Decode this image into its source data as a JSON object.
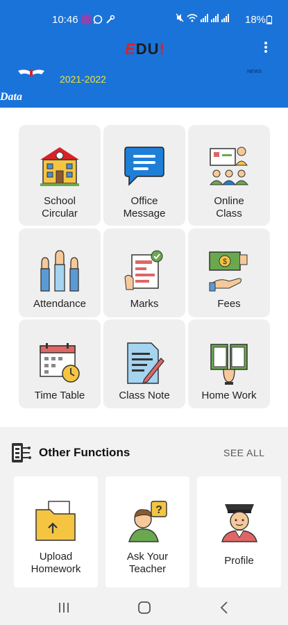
{
  "status_bar": {
    "time": "10:46",
    "battery": "18%",
    "icons": [
      "notification-app-icon",
      "whatsapp-icon",
      "tools-icon",
      "mute-icon",
      "wifi-icon",
      "signal-icon",
      "battery-icon"
    ]
  },
  "header": {
    "logo_e": "E",
    "logo_du": "DU",
    "logo_bang": "!",
    "session_year": "2021-2022",
    "news_label": "NEWS",
    "data_label": "Data"
  },
  "modules": [
    {
      "label": "School\nCircular",
      "icon": "school-building-icon"
    },
    {
      "label": "Office\nMessage",
      "icon": "message-icon"
    },
    {
      "label": "Online\nClass",
      "icon": "online-class-icon"
    },
    {
      "label": "Attendance",
      "icon": "raised-hands-icon"
    },
    {
      "label": "Marks",
      "icon": "marks-sheet-icon"
    },
    {
      "label": "Fees",
      "icon": "fees-money-icon"
    },
    {
      "label": "Time Table",
      "icon": "calendar-clock-icon"
    },
    {
      "label": "Class Note",
      "icon": "note-pen-icon"
    },
    {
      "label": "Home Work",
      "icon": "book-hand-icon"
    }
  ],
  "other_functions": {
    "title": "Other Functions",
    "see_all": "SEE ALL",
    "items": [
      {
        "label": "Upload\nHomework",
        "icon": "upload-folder-icon"
      },
      {
        "label": "Ask Your\nTeacher",
        "icon": "question-person-icon"
      },
      {
        "label": "Profile",
        "icon": "student-profile-icon"
      }
    ]
  },
  "colors": {
    "header_blue": "#1a73d9",
    "accent_yellow": "#f2e433",
    "brand_red": "#d6232a"
  }
}
